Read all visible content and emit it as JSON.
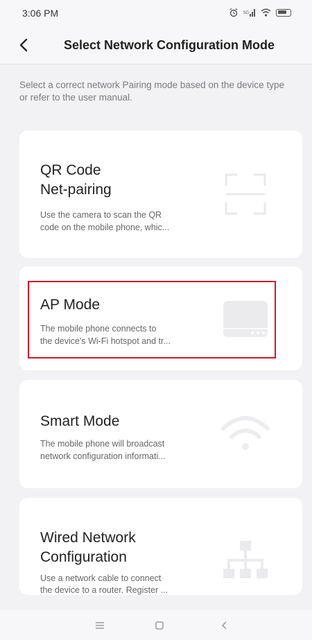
{
  "status_bar": {
    "time": "3:06 PM"
  },
  "header": {
    "title": "Select Network Configuration Mode"
  },
  "description": "Select a correct network Pairing mode based on the device type or refer to the user manual.",
  "modes": [
    {
      "title_line1": "QR Code",
      "title_line2": "Net-pairing",
      "desc_line1": "Use the camera to scan the QR",
      "desc_line2": "code on the mobile phone, whic...",
      "icon": "qr-scan-icon"
    },
    {
      "title_line1": "AP Mode",
      "desc_line1": "The mobile phone connects to",
      "desc_line2": "the device's Wi-Fi hotspot and tr...",
      "icon": "router-device-icon"
    },
    {
      "title_line1": "Smart Mode",
      "desc_line1": "The mobile phone will broadcast",
      "desc_line2": "network configuration informati...",
      "icon": "wifi-icon"
    },
    {
      "title_line1": "Wired Network",
      "title_line2": "Configuration",
      "desc_line1": "Use a network cable to connect",
      "desc_line2": "the device to a router. Register ...",
      "icon": "network-topology-icon"
    }
  ],
  "colors": {
    "highlight": "#cc1a2c",
    "background": "#f2f2f4"
  }
}
